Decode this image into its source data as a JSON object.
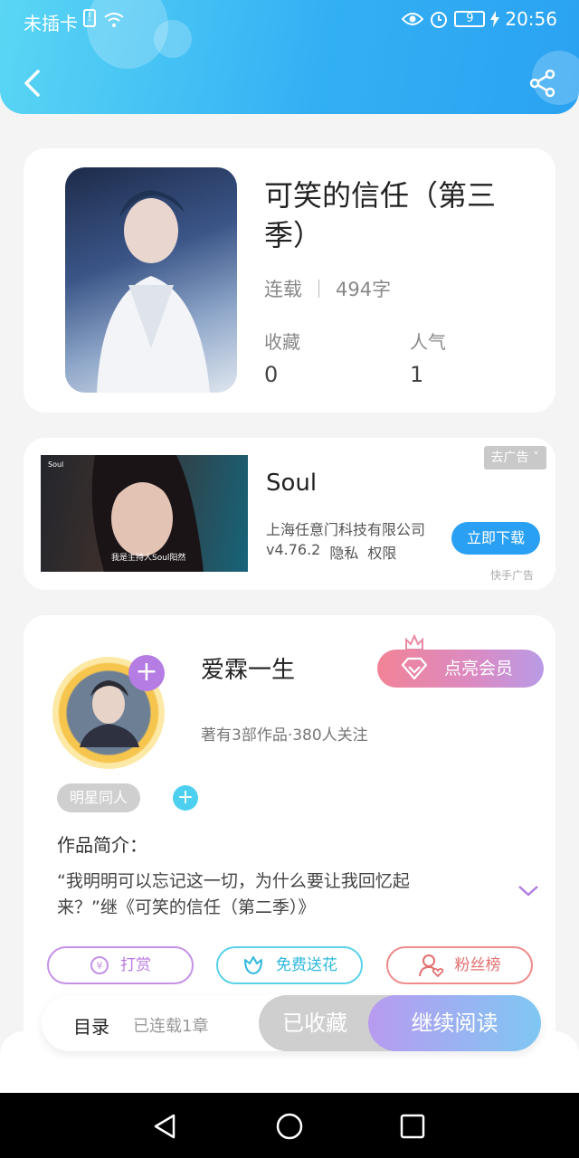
{
  "status_bar": {
    "carrier": "未插卡",
    "battery": "9",
    "time": "20:56"
  },
  "book": {
    "title": "可笑的信任（第三季）",
    "status": "连载",
    "word_count": "494字",
    "stats": [
      {
        "label": "收藏",
        "value": "0"
      },
      {
        "label": "人气",
        "value": "1"
      }
    ]
  },
  "ad": {
    "close_label": "去广告",
    "app_name": "Soul",
    "company": "上海任意门科技有限公司",
    "version": "v4.76.2",
    "privacy": "隐私",
    "permissions": "权限",
    "download_label": "立即下载",
    "source": "快手广告",
    "image_caption": "我是主持人Soul阳然",
    "image_logo": "Soul"
  },
  "author": {
    "name": "爱霖一生",
    "stats": "著有3部作品·380人关注",
    "vip_label": "点亮会员",
    "tag": "明星同人"
  },
  "intro": {
    "label": "作品简介：",
    "text": "“我明明可以忘记这一切，为什么要让我回忆起来？”继《可笑的信任（第二季）》"
  },
  "actions": {
    "tip": "打赏",
    "flower": "免费送花",
    "fans": "粉丝榜"
  },
  "bottom_bar": {
    "toc": "目录",
    "toc_count": "已连载1章",
    "collected": "已收藏",
    "read": "继续阅读"
  }
}
